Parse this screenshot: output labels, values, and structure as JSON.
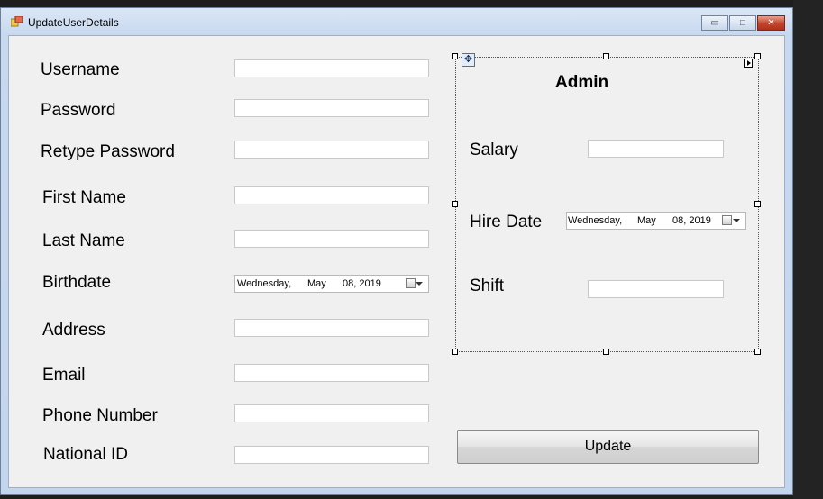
{
  "window": {
    "title": "UpdateUserDetails",
    "icon": "form-app-icon",
    "minimize_glyph": "▭",
    "maximize_glyph": "□",
    "close_glyph": "✕"
  },
  "form": {
    "labels": {
      "username": "Username",
      "password": "Password",
      "retype_password": "Retype Password",
      "first_name": "First Name",
      "last_name": "Last Name",
      "birthdate": "Birthdate",
      "address": "Address",
      "email": "Email",
      "phone_number": "Phone Number",
      "national_id": "National ID"
    },
    "values": {
      "username": "",
      "password": "",
      "retype_password": "",
      "first_name": "",
      "last_name": "",
      "address": "",
      "email": "",
      "phone_number": "",
      "national_id": ""
    },
    "birthdate": {
      "weekday": "Wednesday,",
      "month": "May",
      "day_year": "08, 2019"
    }
  },
  "admin_group": {
    "title": "Admin",
    "labels": {
      "salary": "Salary",
      "hire_date": "Hire Date",
      "shift": "Shift"
    },
    "values": {
      "salary": "",
      "shift": ""
    },
    "hire_date": {
      "weekday": "Wednesday,",
      "month": "May",
      "day_year": "08, 2019"
    },
    "move_glyph": "✥"
  },
  "update_button": {
    "label": "Update"
  }
}
